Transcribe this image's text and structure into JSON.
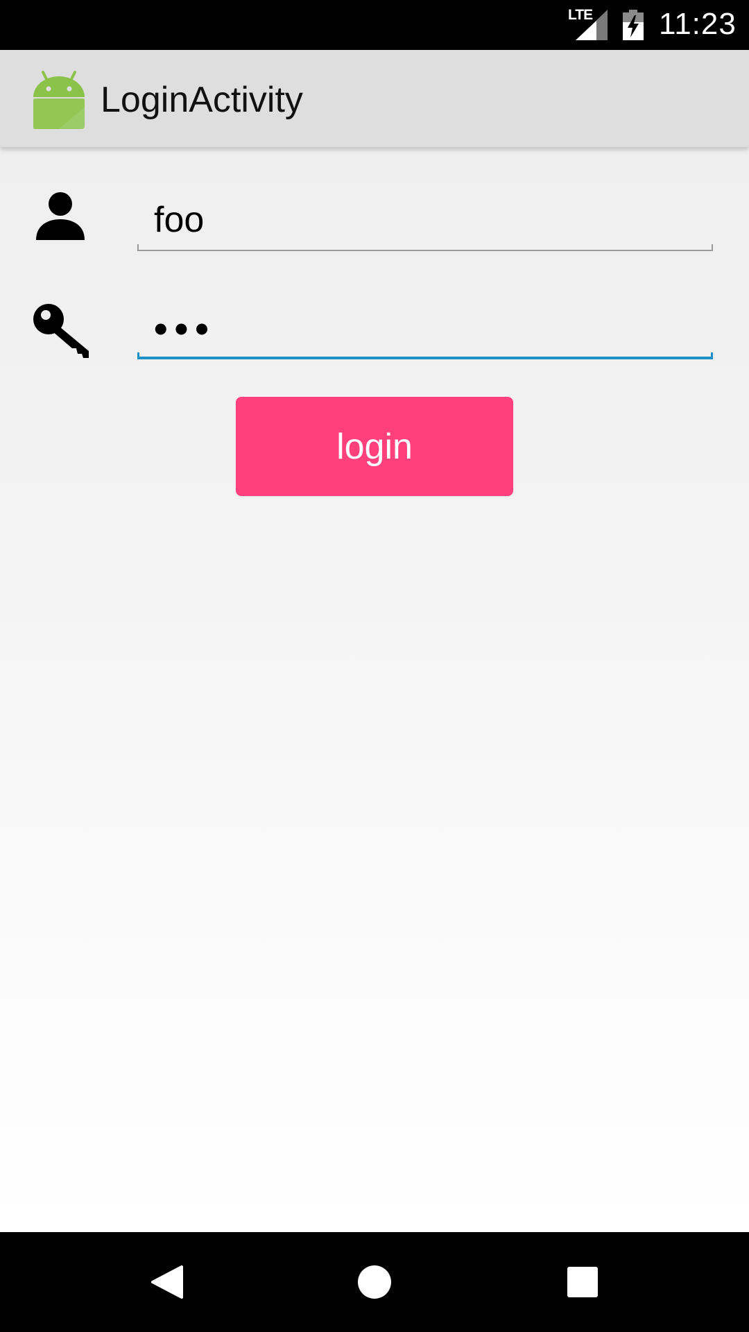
{
  "status_bar": {
    "network": "LTE",
    "time": "11:23"
  },
  "app_bar": {
    "icon": "android-icon",
    "title": "LoginActivity"
  },
  "form": {
    "username_icon": "person-icon",
    "username_value": "foo",
    "password_icon": "key-icon",
    "password_value": "•••",
    "login_label": "login"
  },
  "nav_bar": {
    "back_icon": "back-icon",
    "home_icon": "home-icon",
    "recents_icon": "recents-icon"
  },
  "colors": {
    "accent": "#FF407C",
    "focus": "#1E90C8",
    "app_bar": "#DEDEDE",
    "android_green": "#8BC34A"
  }
}
